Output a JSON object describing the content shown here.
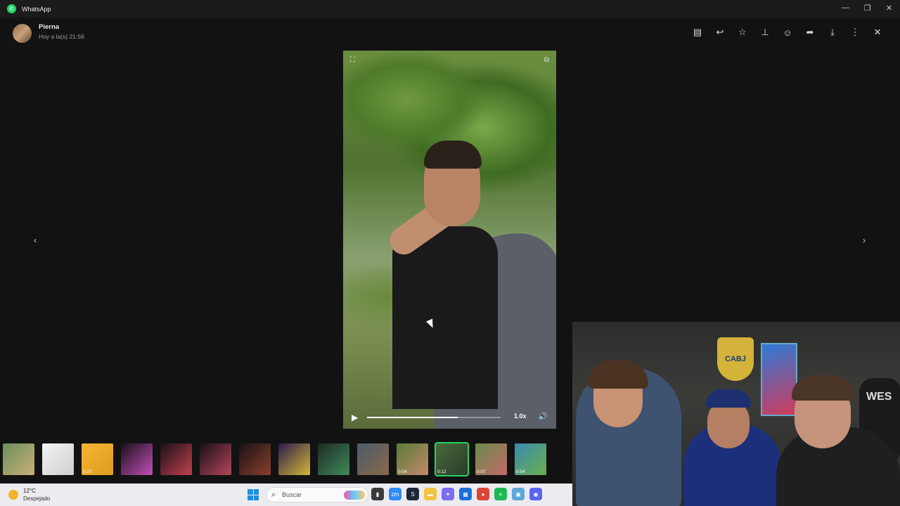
{
  "titlebar": {
    "app_title": "WhatsApp",
    "minimize": "—",
    "restore": "❐",
    "close": "✕"
  },
  "header": {
    "contact_name": "Pierna",
    "timestamp": "Hoy a la(s) 21:56",
    "actions": [
      {
        "name": "select-text-icon",
        "glyph": "▤"
      },
      {
        "name": "reply-icon",
        "glyph": "↩"
      },
      {
        "name": "star-icon",
        "glyph": "☆"
      },
      {
        "name": "pin-icon",
        "glyph": "⊥"
      },
      {
        "name": "emoji-icon",
        "glyph": "☺"
      },
      {
        "name": "forward-icon",
        "glyph": "➦"
      },
      {
        "name": "download-icon",
        "glyph": "⤓"
      },
      {
        "name": "more-icon",
        "glyph": "⋮"
      },
      {
        "name": "close-icon",
        "glyph": "✕"
      }
    ]
  },
  "viewer": {
    "prev": "‹",
    "next": "›",
    "player": {
      "play_icon": "▶",
      "progress": 0.68,
      "speed": "1.0x",
      "volume_icon": "🔊"
    }
  },
  "thumbnails": [
    {
      "name": "thumb-1",
      "duration": "",
      "colors": [
        "#6b8f5a",
        "#c9b07a"
      ]
    },
    {
      "name": "thumb-2",
      "duration": "",
      "colors": [
        "#f4f4f4",
        "#cfcfcf"
      ]
    },
    {
      "name": "thumb-3",
      "duration": "0:27",
      "colors": [
        "#f2b533",
        "#e09c1e"
      ]
    },
    {
      "name": "thumb-4",
      "duration": "",
      "colors": [
        "#1a1018",
        "#c24fb8"
      ]
    },
    {
      "name": "thumb-5",
      "duration": "",
      "colors": [
        "#1a1018",
        "#c2404f"
      ]
    },
    {
      "name": "thumb-6",
      "duration": "",
      "colors": [
        "#1a1018",
        "#b3465a"
      ]
    },
    {
      "name": "thumb-7",
      "duration": "",
      "colors": [
        "#1a1018",
        "#8a3f2a"
      ]
    },
    {
      "name": "thumb-8",
      "duration": "",
      "colors": [
        "#2a1a4a",
        "#d4b83a"
      ]
    },
    {
      "name": "thumb-9",
      "duration": "",
      "colors": [
        "#1e2a24",
        "#3f8a5a"
      ]
    },
    {
      "name": "thumb-10",
      "duration": "",
      "colors": [
        "#4a5a6a",
        "#8a6a4a"
      ]
    },
    {
      "name": "thumb-11",
      "duration": "0:04",
      "colors": [
        "#5a7a3a",
        "#c28a6a"
      ]
    },
    {
      "name": "thumb-12",
      "duration": "0:12",
      "colors": [
        "#4a6a3a",
        "#2a3a2a"
      ],
      "selected": true
    },
    {
      "name": "thumb-13",
      "duration": "0:07",
      "colors": [
        "#6a8a4a",
        "#c26a6a"
      ]
    },
    {
      "name": "thumb-14",
      "duration": "0:54",
      "colors": [
        "#3a8ab0",
        "#6ab04a"
      ]
    }
  ],
  "webcam": {
    "shield_text": "CABJ",
    "chair_text": "WES"
  },
  "taskbar": {
    "weather_temp": "12°C",
    "weather_desc": "Despejado",
    "search_placeholder": "Buscar",
    "apps": [
      {
        "name": "file-explorer-icon",
        "glyph": "▮",
        "color": "#3a3a3a"
      },
      {
        "name": "zoom-icon",
        "glyph": "zm",
        "color": "#2d8cff"
      },
      {
        "name": "steam-icon",
        "glyph": "S",
        "color": "#1b2838"
      },
      {
        "name": "folder-icon",
        "glyph": "▬",
        "color": "#f5c342"
      },
      {
        "name": "copilot-icon",
        "glyph": "✦",
        "color": "#7b6cf0"
      },
      {
        "name": "store-icon",
        "glyph": "▦",
        "color": "#1d6ed8"
      },
      {
        "name": "chrome-icon",
        "glyph": "●",
        "color": "#db4437"
      },
      {
        "name": "spotify-icon",
        "glyph": "≡",
        "color": "#1db954"
      },
      {
        "name": "photos-icon",
        "glyph": "▣",
        "color": "#5aa7d8"
      },
      {
        "name": "discord-icon",
        "glyph": "◉",
        "color": "#5865f2"
      }
    ]
  }
}
